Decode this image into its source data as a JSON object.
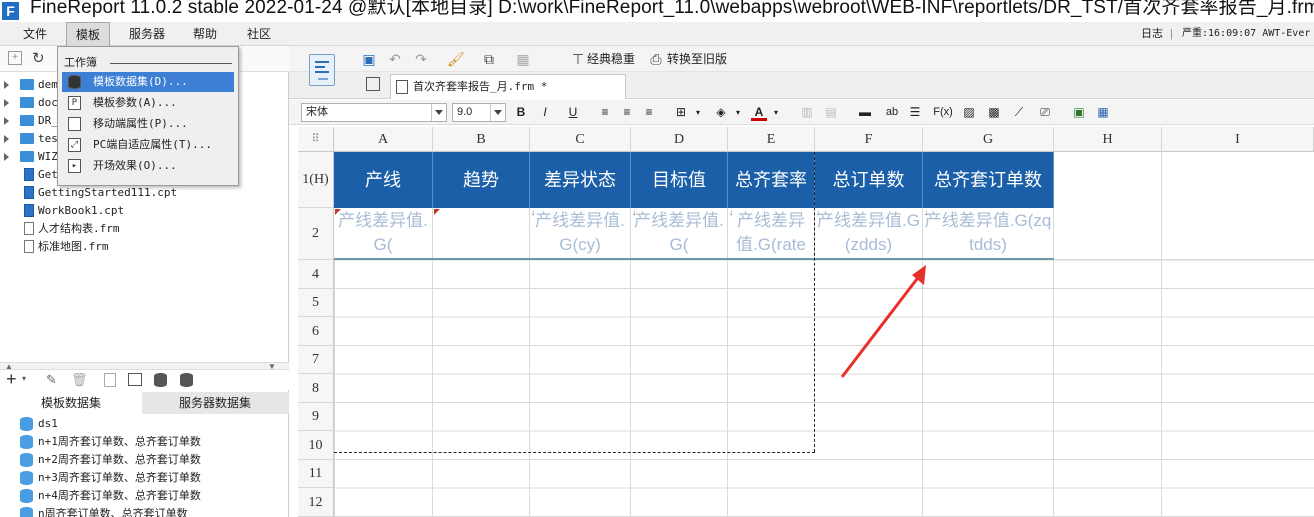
{
  "title_bar": {
    "text": "FineReport 11.0.2 stable 2022-01-24 @默认[本地目录]    D:\\work\\FineReport_11.0\\webapps\\webroot\\WEB-INF\\reportlets/DR_TST/首次齐套率报告_月.frm"
  },
  "menu": {
    "items": [
      "文件",
      "模板",
      "服务器",
      "帮助",
      "社区"
    ],
    "active": "模板",
    "right_log": "日志",
    "right_sep": "|",
    "right_severity": "严重:16:09:07 AWT-Ever"
  },
  "template_menu": {
    "section": "工作簿",
    "items": [
      {
        "label": "模板数据集(D)...",
        "icon": "database-icon"
      },
      {
        "label": "模板参数(A)...",
        "icon": "parameter-icon"
      },
      {
        "label": "移动端属性(P)...",
        "icon": "mobile-icon"
      },
      {
        "label": "PC端自适应属性(T)...",
        "icon": "adaptive-icon"
      },
      {
        "label": "开场效果(O)...",
        "icon": "effect-icon"
      }
    ]
  },
  "file_tree": [
    {
      "label": "dem",
      "type": "folder"
    },
    {
      "label": "doc",
      "type": "folder"
    },
    {
      "label": "DR_",
      "type": "folder"
    },
    {
      "label": "tes",
      "type": "folder"
    },
    {
      "label": "WIZ",
      "type": "folder"
    },
    {
      "label": "Get",
      "type": "cpt"
    },
    {
      "label": "GettingStarted111.cpt",
      "type": "cpt"
    },
    {
      "label": "WorkBook1.cpt",
      "type": "cpt"
    },
    {
      "label": "人才结构表.frm",
      "type": "frm"
    },
    {
      "label": "标准地图.frm",
      "type": "frm"
    }
  ],
  "dataset_tabs": [
    "模板数据集",
    "服务器数据集"
  ],
  "datasets": [
    "ds1",
    "n+1周齐套订单数、总齐套订单数",
    "n+2周齐套订单数、总齐套订单数",
    "n+3周齐套订单数、总齐套订单数",
    "n+4周齐套订单数、总齐套订单数",
    "n周齐套订单数、总齐套订单数"
  ],
  "toolbar": {
    "classic": "经典稳重",
    "convert_old": "转换至旧版"
  },
  "document_tab": {
    "label": "首次齐套率报告_月.frm *"
  },
  "format_bar": {
    "font": "宋体",
    "size": "9.0",
    "bold": "B",
    "italic": "I",
    "underline": "U",
    "color_letter": "A",
    "text_tool": "ab",
    "formula_tool": "F(x)"
  },
  "sheet": {
    "columns": [
      "A",
      "B",
      "C",
      "D",
      "E",
      "F",
      "G",
      "H",
      "I"
    ],
    "row_labels": [
      "1(H)",
      "2",
      "4",
      "5",
      "6",
      "7",
      "8",
      "9",
      "10",
      "11",
      "12"
    ],
    "header_cells": [
      "产线",
      "趋势",
      "差异状态",
      "目标值",
      "总齐套率",
      "总订单数",
      "总齐套订单数"
    ],
    "data_cells": [
      "产线差异值.G(",
      "",
      "产线差异值.G(cy)",
      "产线差异值.G(",
      "产线差异值.G(rate",
      "产线差异值.G(zdds)",
      "产线差异值.G(zqtdds)"
    ]
  },
  "colors": {
    "header_fill": "#1a5fa8",
    "header_text": "#ffffff",
    "placeholder_text": "#a9bcd6",
    "arrow": "#e8302a",
    "menu_highlight": "#3c7fd4"
  }
}
